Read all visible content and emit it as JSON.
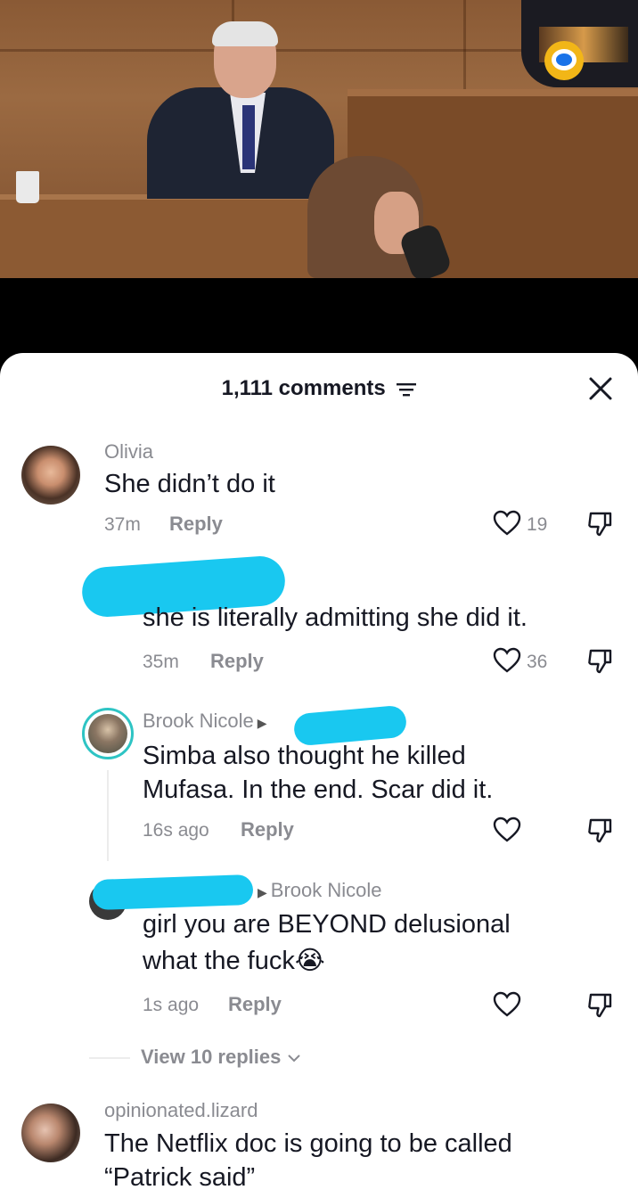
{
  "header": {
    "count_label": "1,111 comments"
  },
  "comments": [
    {
      "username": "Olivia",
      "text": "She didn’t do it",
      "time": "37m",
      "reply": "Reply",
      "likes": "19"
    },
    {
      "username": "",
      "text": "she is literally admitting she did it.",
      "time": "35m",
      "reply": "Reply",
      "likes": "36"
    },
    {
      "username": "Brook Nicole",
      "text_line1": "Simba also thought he killed",
      "text_line2": "Mufasa. In the end. Scar did it.",
      "time": "16s ago",
      "reply": "Reply"
    },
    {
      "reply_to": "Brook Nicole",
      "text_line1": "girl you are BEYOND delusional",
      "text_line2": "what the fuck😭",
      "time": "1s ago",
      "reply": "Reply"
    }
  ],
  "view_replies": "View 10 replies",
  "last_comment": {
    "username": "opinionated.lizard",
    "text_line1": "The Netflix doc is going to be called",
    "text_line2": "“Patrick said”"
  },
  "colors": {
    "redaction": "#19c8f0",
    "muted": "#8a8b91"
  }
}
